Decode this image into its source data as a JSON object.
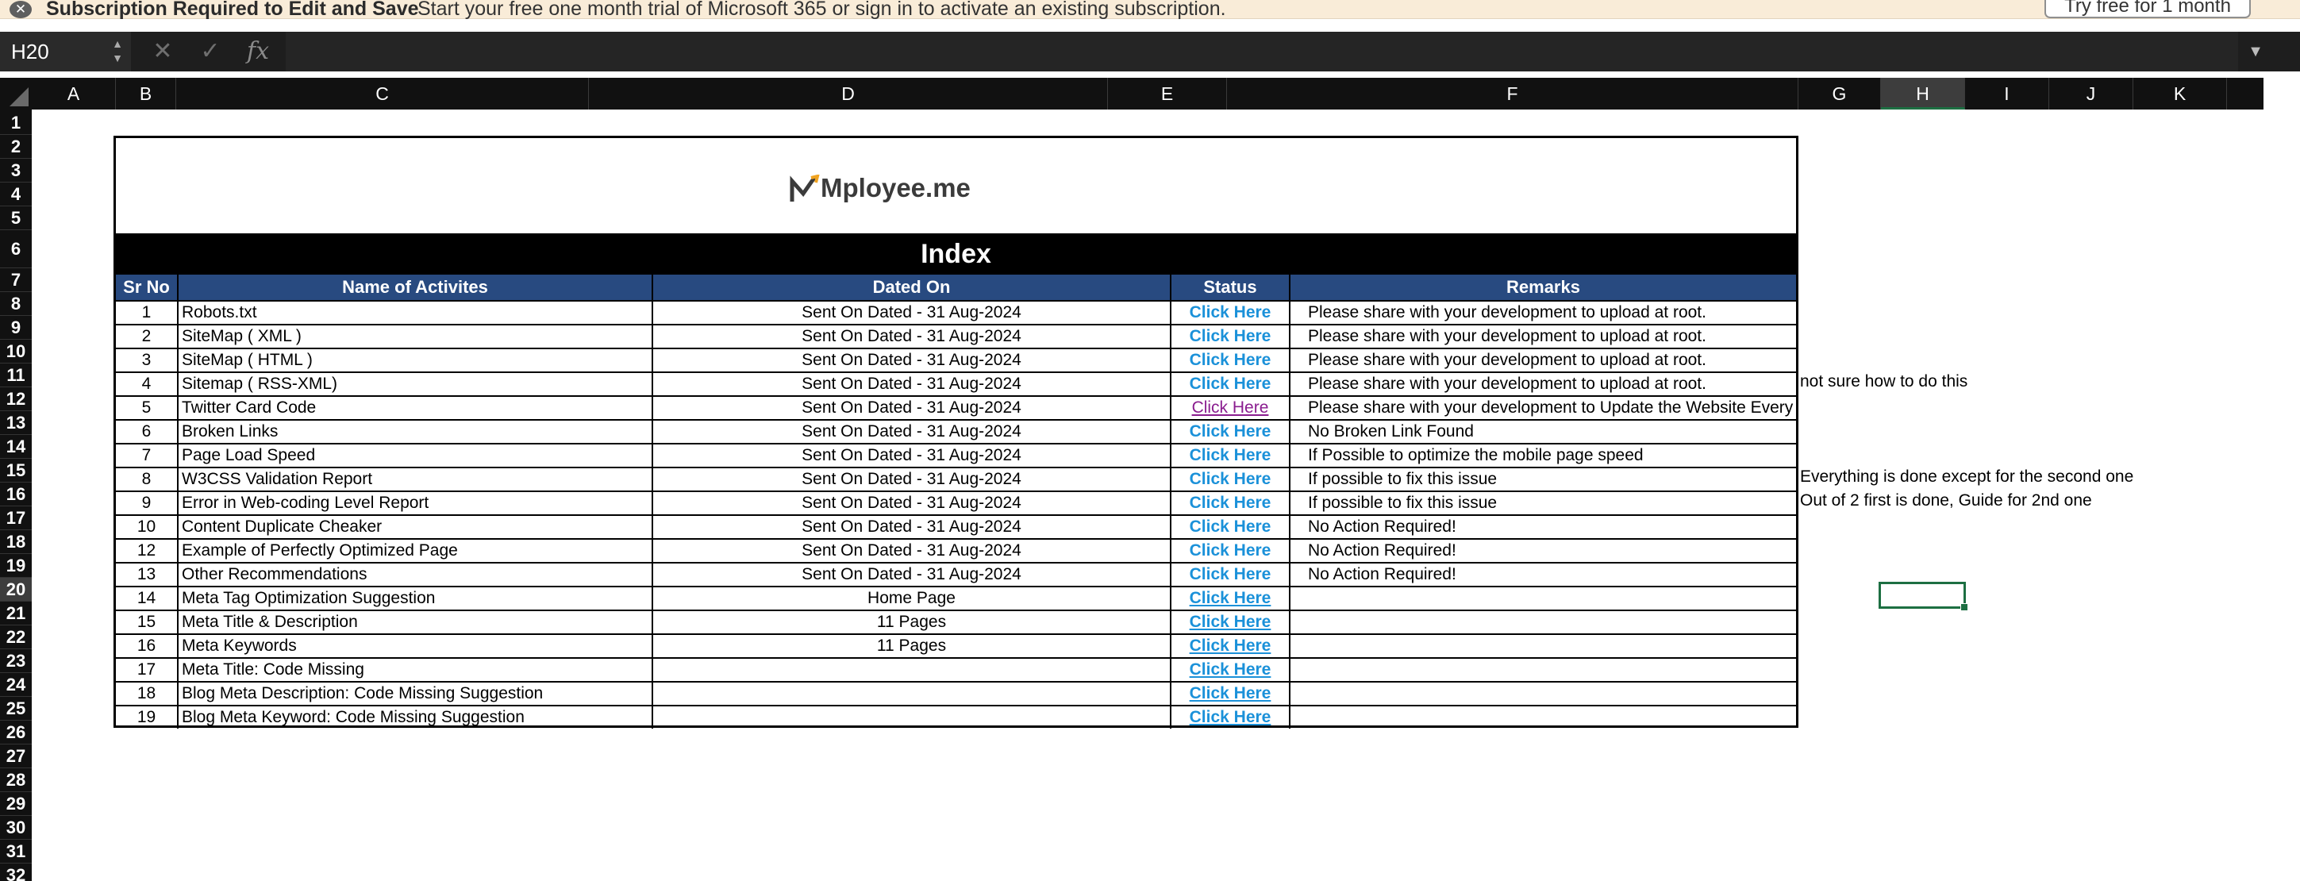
{
  "notice": {
    "title": "Subscription Required to Edit and Save",
    "message": "Start your free one month trial of Microsoft 365 or sign in to activate an existing subscription.",
    "try_button": "Try free for 1 month"
  },
  "formula_bar": {
    "name_box": "H20",
    "fx_symbol": "fx",
    "cancel_symbol": "✕",
    "confirm_symbol": "✓",
    "value": ""
  },
  "columns": [
    "A",
    "B",
    "C",
    "D",
    "E",
    "F",
    "G",
    "H",
    "I",
    "J",
    "K"
  ],
  "selected_column": "H",
  "rows": [
    "1",
    "2",
    "3",
    "4",
    "5",
    "6",
    "7",
    "8",
    "9",
    "10",
    "11",
    "12",
    "13",
    "14",
    "15",
    "16",
    "17",
    "18",
    "19",
    "20",
    "21",
    "22",
    "23",
    "24",
    "25",
    "26",
    "27",
    "28",
    "29",
    "30",
    "31",
    "32"
  ],
  "selected_row": "20",
  "sheet": {
    "logo_text": "Mployee.me",
    "index_title": "Index",
    "headers": {
      "sr": "Sr No",
      "name": "Name of Activites",
      "date": "Dated On",
      "status": "Status",
      "remarks": "Remarks"
    },
    "rows": [
      {
        "sr": "1",
        "name": "Robots.txt",
        "date": "Sent On Dated - 31 Aug-2024",
        "status": "Click Here",
        "remarks": "Please share with your development to upload at root."
      },
      {
        "sr": "2",
        "name": "SiteMap ( XML )",
        "date": "Sent On Dated - 31 Aug-2024",
        "status": "Click Here",
        "remarks": "Please share with your development to upload at root."
      },
      {
        "sr": "3",
        "name": "SiteMap ( HTML )",
        "date": "Sent On Dated - 31 Aug-2024",
        "status": "Click Here",
        "remarks": "Please share with your development to upload at root."
      },
      {
        "sr": "4",
        "name": "Sitemap ( RSS-XML)",
        "date": "Sent On Dated - 31 Aug-2024",
        "status": "Click Here",
        "remarks": "Please share with your development to upload at root."
      },
      {
        "sr": "5",
        "name": "Twitter Card Code",
        "date": "Sent On Dated - 31 Aug-2024",
        "status": "Click Here",
        "remarks": "Please share with your development to Update the Website Every Pages"
      },
      {
        "sr": "6",
        "name": "Broken Links",
        "date": "Sent On Dated - 31 Aug-2024",
        "status": "Click Here",
        "remarks": "No Broken Link Found"
      },
      {
        "sr": "7",
        "name": "Page Load Speed",
        "date": "Sent On Dated - 31 Aug-2024",
        "status": "Click Here",
        "remarks": "If Possible to optimize the mobile page speed"
      },
      {
        "sr": "8",
        "name": "W3CSS Validation Report",
        "date": "Sent On Dated - 31 Aug-2024",
        "status": "Click Here",
        "remarks": "If possible to fix this issue"
      },
      {
        "sr": "9",
        "name": "Error in Web-coding Level Report",
        "date": "Sent On Dated - 31 Aug-2024",
        "status": "Click Here",
        "remarks": "If possible to fix this issue"
      },
      {
        "sr": "10",
        "name": "Content Duplicate Cheaker",
        "date": "Sent On Dated - 31 Aug-2024",
        "status": "Click Here",
        "remarks": "No Action Required!"
      },
      {
        "sr": "12",
        "name": "Example of Perfectly Optimized Page",
        "date": "Sent On Dated - 31 Aug-2024",
        "status": "Click Here",
        "remarks": "No Action Required!"
      },
      {
        "sr": "13",
        "name": "Other Recommendations",
        "date": "Sent On Dated - 31 Aug-2024",
        "status": "Click Here",
        "remarks": "No Action Required!"
      },
      {
        "sr": "14",
        "name": "Meta Tag Optimization Suggestion",
        "date": "Home Page",
        "status": "Click Here",
        "remarks": ""
      },
      {
        "sr": "15",
        "name": "Meta Title & Description",
        "date": "11 Pages",
        "status": "Click Here",
        "remarks": ""
      },
      {
        "sr": "16",
        "name": "Meta Keywords",
        "date": "11 Pages",
        "status": "Click Here",
        "remarks": ""
      },
      {
        "sr": "17",
        "name": "Meta Title: Code Missing",
        "date": "",
        "status": "Click Here",
        "remarks": ""
      },
      {
        "sr": "18",
        "name": "Blog Meta Description: Code Missing Suggestion",
        "date": "",
        "status": "Click Here",
        "remarks": ""
      },
      {
        "sr": "19",
        "name": "Blog Meta Keyword: Code Missing Suggestion",
        "date": "",
        "status": "Click Here",
        "remarks": ""
      }
    ],
    "side_notes": {
      "row11": "not sure how to do this",
      "row15": "Everything is done except for the second one",
      "row16": "Out of 2 first is done, Guide for 2nd one"
    }
  },
  "colors": {
    "header_blue": "#284a80",
    "link_blue": "#1b91d9",
    "visited_purple": "#8a1d8f",
    "selection_green": "#1d6f42",
    "notice_bg": "#f9ecd8"
  }
}
